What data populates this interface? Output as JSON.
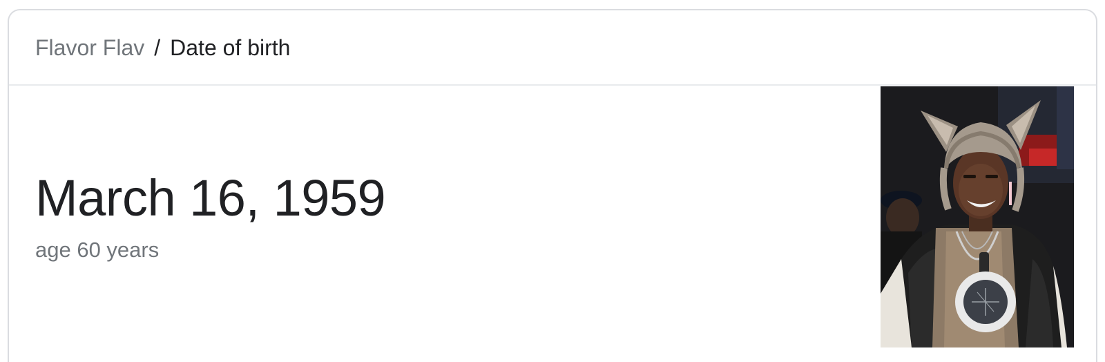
{
  "breadcrumb": {
    "parent": "Flavor Flav",
    "separator": "/",
    "current": "Date of birth"
  },
  "answer": {
    "value": "March 16, 1959",
    "subtitle": "age 60 years"
  },
  "colors": {
    "primary_text": "#202124",
    "secondary_text": "#70757a",
    "border": "#dadce0",
    "divider": "#e8eaed"
  }
}
